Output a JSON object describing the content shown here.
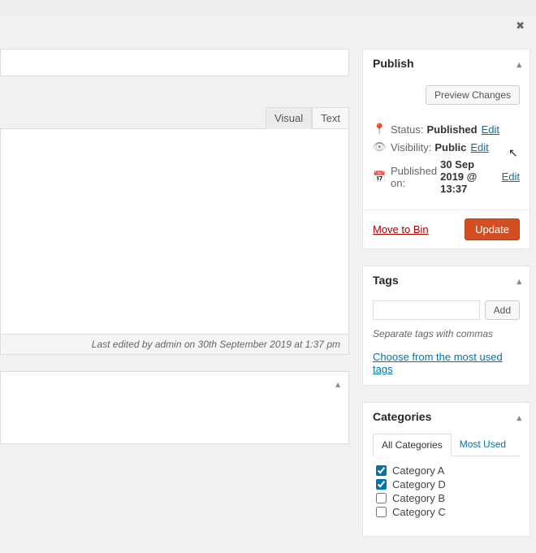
{
  "topbar": {},
  "editor": {
    "tab_visual": "Visual",
    "tab_text": "Text",
    "status_line": "Last edited by admin on 30th September 2019 at 1:37 pm"
  },
  "publish": {
    "heading": "Publish",
    "preview_btn": "Preview Changes",
    "status_label": "Status:",
    "status_value": "Published",
    "status_edit": "Edit",
    "visibility_label": "Visibility:",
    "visibility_value": "Public",
    "visibility_edit": "Edit",
    "published_label": "Published on:",
    "published_value": "30 Sep 2019 @ 13:37",
    "published_edit": "Edit",
    "trash": "Move to Bin",
    "update_btn": "Update"
  },
  "tags": {
    "heading": "Tags",
    "add_btn": "Add",
    "hint": "Separate tags with commas",
    "choose_link": "Choose from the most used tags"
  },
  "categories": {
    "heading": "Categories",
    "tab_all": "All Categories",
    "tab_most": "Most Used",
    "items": [
      {
        "label": "Category A",
        "checked": true
      },
      {
        "label": "Category D",
        "checked": true
      },
      {
        "label": "Category B",
        "checked": false
      },
      {
        "label": "Category C",
        "checked": false
      }
    ]
  }
}
